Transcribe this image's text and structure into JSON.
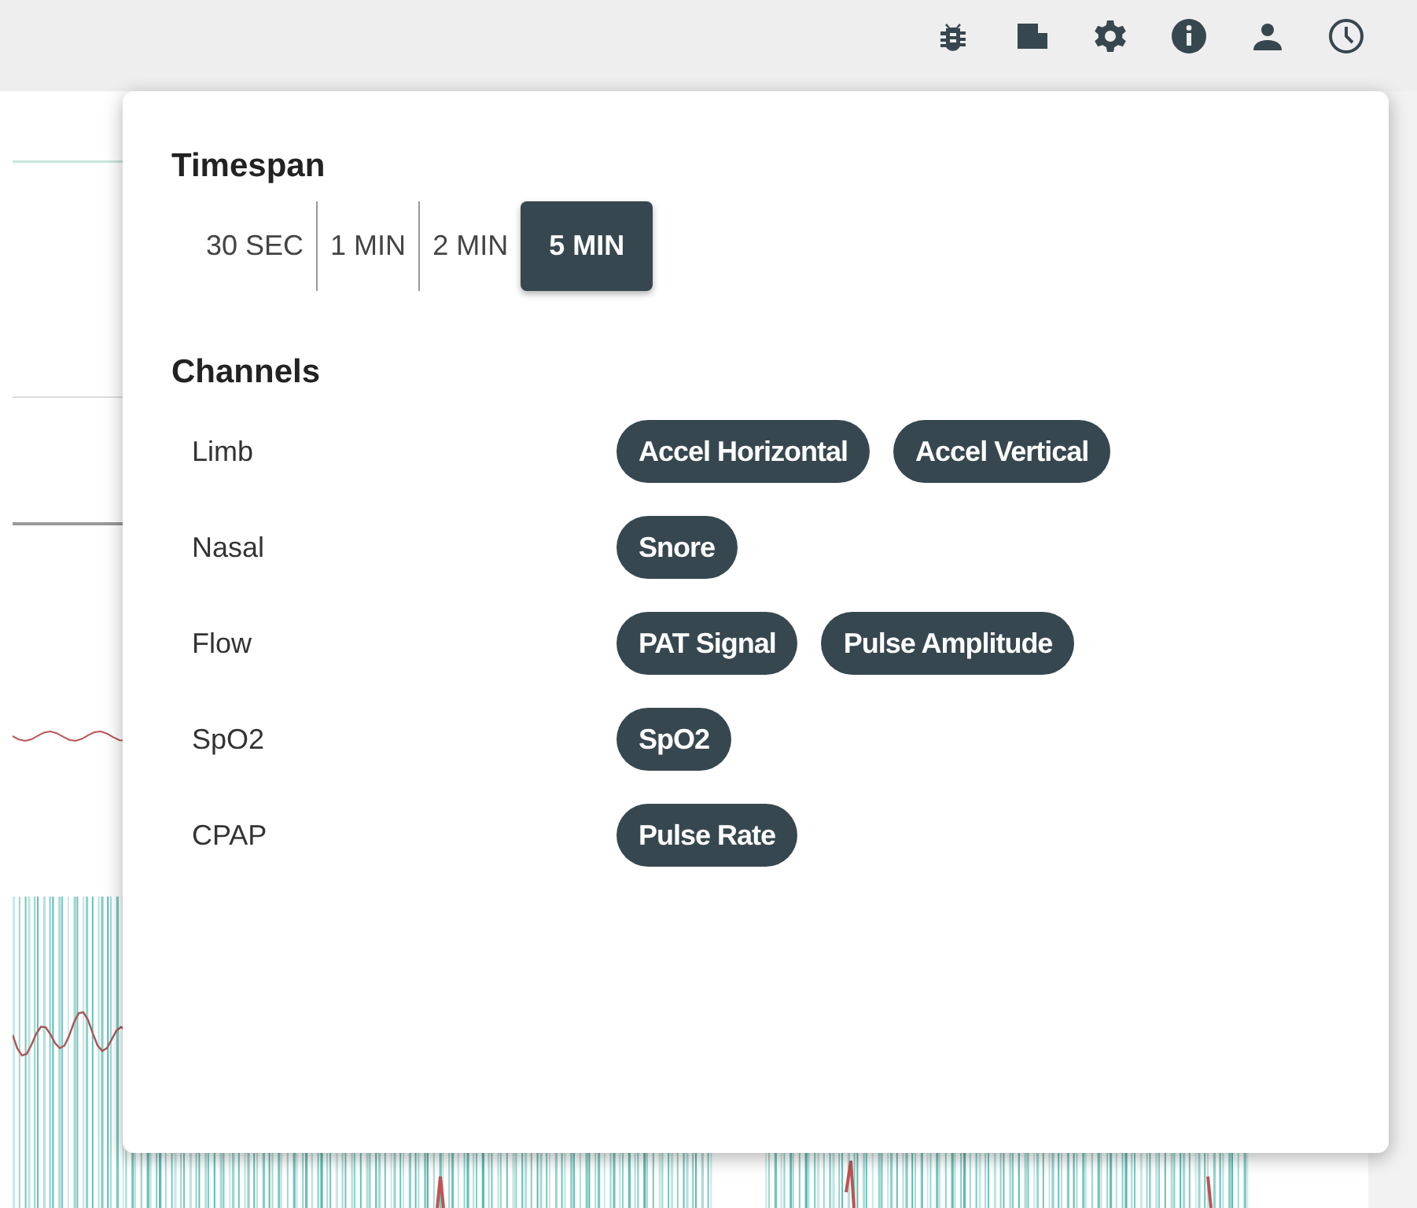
{
  "timespan": {
    "title": "Timespan",
    "options": [
      {
        "label": "30 SEC",
        "selected": false
      },
      {
        "label": "1 MIN",
        "selected": false
      },
      {
        "label": "2 MIN",
        "selected": false
      },
      {
        "label": "5 MIN",
        "selected": true
      }
    ]
  },
  "channels": {
    "title": "Channels",
    "groups": [
      {
        "label": "Limb",
        "chips": [
          "Accel Horizontal",
          "Accel Vertical"
        ]
      },
      {
        "label": "Nasal",
        "chips": [
          "Snore"
        ]
      },
      {
        "label": "Flow",
        "chips": [
          "PAT Signal",
          "Pulse Amplitude"
        ]
      },
      {
        "label": "SpO2",
        "chips": [
          "SpO2"
        ]
      },
      {
        "label": "CPAP",
        "chips": [
          "Pulse Rate"
        ]
      }
    ]
  }
}
